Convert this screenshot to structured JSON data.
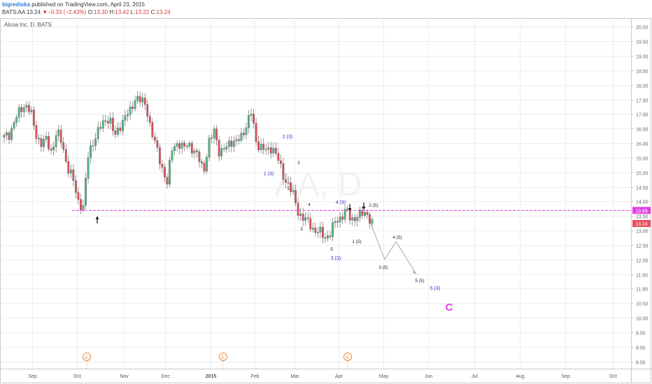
{
  "header": {
    "author": "bigrediska",
    "published": " published on TradingView.com, April 23, 2015",
    "symbol": "BATS:AA",
    "last": "13.24",
    "change_arrow": "▼",
    "change": "−0.33 (−2.43%)",
    "ohlc_open_label": "O:",
    "ohlc_open": "13.30",
    "ohlc_high_label": "H:",
    "ohlc_high": "13.42",
    "ohlc_low_label": "L:",
    "ohlc_low": "13.22",
    "ohlc_close_label": "C:",
    "ohlc_close": "13.24"
  },
  "pane_title": "Alcoa Inc, D, BATS",
  "watermark": "AA, D",
  "colors": {
    "up": "#53b987",
    "down": "#eb4d5c",
    "support_line": "#e040e0",
    "wave_blue": "#2f2fd0",
    "wave_black": "#222222",
    "big_c": "#e040e0",
    "earnings": "#e8873a",
    "projection": "#aaaaaa",
    "last_price_tag": "#eb4d5c"
  },
  "chart_data": {
    "type": "candlestick",
    "ylim": [
      8.25,
      20.3
    ],
    "y_ticks": [
      "8.50",
      "9.00",
      "9.50",
      "10.00",
      "10.50",
      "11.00",
      "11.50",
      "12.00",
      "12.50",
      "13.00",
      "13.50",
      "14.00",
      "14.50",
      "15.00",
      "15.50",
      "16.00",
      "16.50",
      "17.00",
      "17.50",
      "18.00",
      "18.50",
      "19.00",
      "19.50",
      "20.00"
    ],
    "x_labels": [
      "Sep",
      "Oct",
      "Nov",
      "Dec",
      "2015",
      "Feb",
      "Mar",
      "Apr",
      "May",
      "Jun",
      "Jul",
      "Aug",
      "Sep",
      "Oct"
    ],
    "support_level": 13.69,
    "support_label": "13.69",
    "last_price": 13.24,
    "last_price_label": "13.24",
    "trend_anchors": [
      [
        16.2,
        16.3,
        16.8,
        17.1,
        17.35,
        17.1,
        16.3,
        16.0,
        16.1,
        15.7,
        16.4,
        16.0,
        15.2,
        14.8,
        14.05,
        13.75,
        15.6,
        16.1,
        16.45,
        16.75,
        16.9,
        16.2,
        16.6,
        16.9,
        17.1,
        17.6,
        17.45,
        17.3,
        16.4,
        15.8,
        15.2,
        14.6,
        15.9,
        16.0,
        15.8,
        16.05,
        15.7,
        15.5,
        15.1,
        16.0,
        16.5,
        15.6,
        15.8,
        16.1,
        16.0,
        16.2,
        16.6,
        17.05,
        16.0,
        15.85,
        15.7,
        15.9,
        15.5,
        14.9,
        14.6,
        14.2,
        13.6,
        13.4,
        13.25,
        13.0,
        12.95,
        12.75,
        12.9,
        13.3,
        13.45,
        13.7,
        13.35,
        13.5,
        13.55,
        13.6,
        13.24
      ]
    ],
    "projection_path": [
      13.24,
      12.0,
      12.62,
      11.5
    ],
    "wave_labels_blue": [
      "2 (3)",
      "1 (3)",
      "3 (3)",
      "4 (3)",
      "5 (3)"
    ],
    "wave_labels_black": [
      "2",
      "1",
      "4",
      "3",
      "5",
      "1 (5)",
      "2 (5)",
      "3 (5)",
      "4 (5)",
      "5 (5)"
    ],
    "big_label": "C",
    "earnings_marker": "E"
  }
}
